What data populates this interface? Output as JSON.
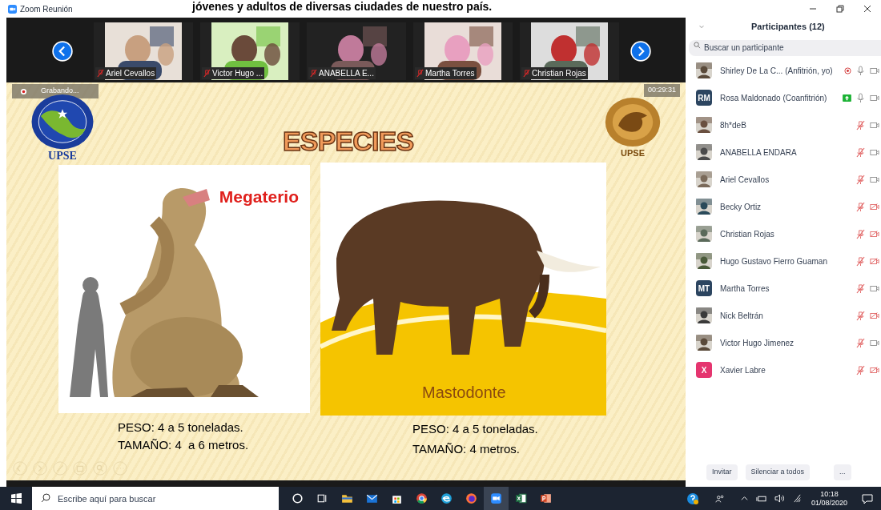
{
  "caption": "jóvenes y adultos de diversas ciudades de nuestro país.",
  "window": {
    "title": "Zoom Reunión"
  },
  "video_strip": {
    "tiles": [
      {
        "name": "Ariel Cevallos",
        "muted": true
      },
      {
        "name": "Victor Hugo ...",
        "muted": true
      },
      {
        "name": "ANABELLA E...",
        "muted": true
      },
      {
        "name": "Martha Torres",
        "muted": true
      },
      {
        "name": "Christian Rojas",
        "muted": true
      }
    ]
  },
  "recording": {
    "label": "Grabando..."
  },
  "timer": "00:29:31",
  "slide": {
    "title": "ESPECIES",
    "left_logo_text": "UPSE",
    "right_logo_text": "UPSE",
    "species": [
      {
        "name": "Megaterio",
        "kind": "sloth",
        "weight_label": "PESO:",
        "weight": "4 a 5 toneladas.",
        "size_label": "TAMAÑO:",
        "size": "4  a 6 metros."
      },
      {
        "name": "Mastodonte",
        "kind": "mastodon",
        "weight_label": "PESO:",
        "weight": "4 a 5 toneladas.",
        "size_label": "TAMAÑO:",
        "size": "4 metros."
      }
    ]
  },
  "participants_panel": {
    "title": "Participantes (12)",
    "search": {
      "placeholder": "Buscar un participante"
    },
    "participants": [
      {
        "name": "Shirley De La C... (Anfitrión, yo)",
        "recording": true,
        "sharing": false,
        "mic_muted": false,
        "video_off": false
      },
      {
        "name": "Rosa Maldonado (Coanfitrión)",
        "avatar": {
          "kind": "initials",
          "text": "RM",
          "color": "#2c4560"
        },
        "recording": false,
        "sharing": true,
        "mic_muted": false,
        "video_off": false
      },
      {
        "name": "8h*deB",
        "recording": false,
        "sharing": false,
        "mic_muted": true,
        "video_off": false
      },
      {
        "name": "ANABELLA ENDARA",
        "recording": false,
        "sharing": false,
        "mic_muted": true,
        "video_off": false
      },
      {
        "name": "Ariel Cevallos",
        "recording": false,
        "sharing": false,
        "mic_muted": true,
        "video_off": false
      },
      {
        "name": "Becky Ortiz",
        "recording": false,
        "sharing": false,
        "mic_muted": true,
        "video_off": true
      },
      {
        "name": "Christian Rojas",
        "recording": false,
        "sharing": false,
        "mic_muted": true,
        "video_off": true
      },
      {
        "name": "Hugo Gustavo Fierro Guaman",
        "recording": false,
        "sharing": false,
        "mic_muted": true,
        "video_off": true
      },
      {
        "name": "Martha Torres",
        "avatar": {
          "kind": "initials",
          "text": "MT",
          "color": "#2c4560"
        },
        "recording": false,
        "sharing": false,
        "mic_muted": true,
        "video_off": false
      },
      {
        "name": "Nick Beltrán",
        "recording": false,
        "sharing": false,
        "mic_muted": true,
        "video_off": true
      },
      {
        "name": "Victor Hugo Jimenez",
        "recording": false,
        "sharing": false,
        "mic_muted": true,
        "video_off": false
      },
      {
        "name": "Xavier Labre",
        "avatar": {
          "kind": "initials",
          "text": "X",
          "color": "#e5356f"
        },
        "recording": false,
        "sharing": false,
        "mic_muted": true,
        "video_off": true
      }
    ],
    "buttons": [
      "Invitar",
      "Silenciar a todos",
      "..."
    ]
  },
  "taskbar": {
    "search": {
      "placeholder": "Escribe aquí para buscar"
    },
    "time": "10:18",
    "date": "01/08/2020"
  }
}
